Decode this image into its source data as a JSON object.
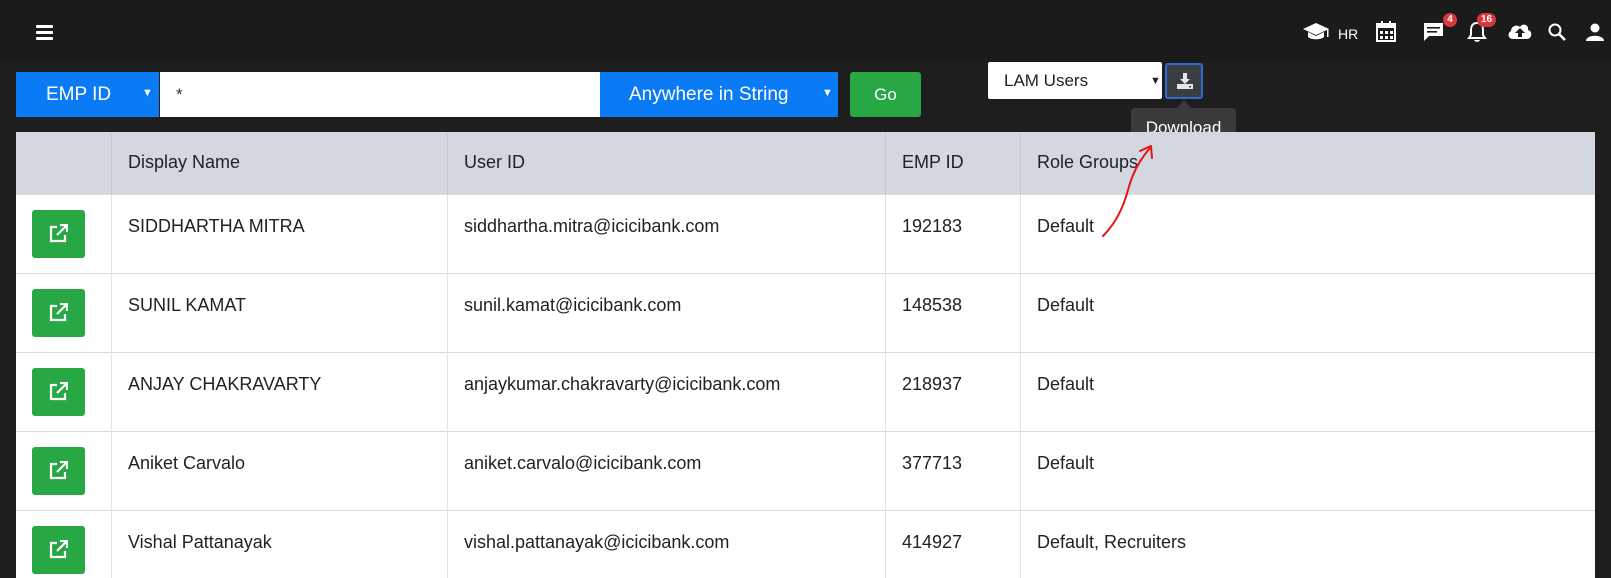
{
  "header": {
    "hr_label": "HR",
    "messages_badge": "4",
    "notifications_badge": "16",
    "icons": [
      "menu-icon",
      "graduation-cap-icon",
      "calendar-icon",
      "chat-icon",
      "bell-icon",
      "cloud-upload-icon",
      "search-icon",
      "user-icon"
    ]
  },
  "search": {
    "field_select": "EMP ID",
    "query_value": "*",
    "match_select": "Anywhere in String",
    "go_label": "Go"
  },
  "export": {
    "list_select": "LAM Users",
    "download_tooltip": "Download"
  },
  "table": {
    "columns": [
      "",
      "Display Name",
      "User ID",
      "EMP ID",
      "Role Groups"
    ],
    "rows": [
      {
        "display_name": "SIDDHARTHA MITRA",
        "user_id": "siddhartha.mitra@icicibank.com",
        "emp_id": "192183",
        "role_groups": "Default"
      },
      {
        "display_name": "SUNIL KAMAT",
        "user_id": "sunil.kamat@icicibank.com",
        "emp_id": "148538",
        "role_groups": "Default"
      },
      {
        "display_name": "ANJAY CHAKRAVARTY",
        "user_id": "anjaykumar.chakravarty@icicibank.com",
        "emp_id": "218937",
        "role_groups": "Default"
      },
      {
        "display_name": "Aniket Carvalo",
        "user_id": "aniket.carvalo@icicibank.com",
        "emp_id": "377713",
        "role_groups": "Default"
      },
      {
        "display_name": "Vishal Pattanayak",
        "user_id": "vishal.pattanayak@icicibank.com",
        "emp_id": "414927",
        "role_groups": "Default, Recruiters"
      }
    ]
  },
  "colors": {
    "topbar": "#1b1b1b",
    "primary_blue": "#0b7bf5",
    "success_green": "#28a745",
    "badge_red": "#d9363e",
    "header_row": "#d3d8e0",
    "annotation_red": "#e8141b"
  }
}
